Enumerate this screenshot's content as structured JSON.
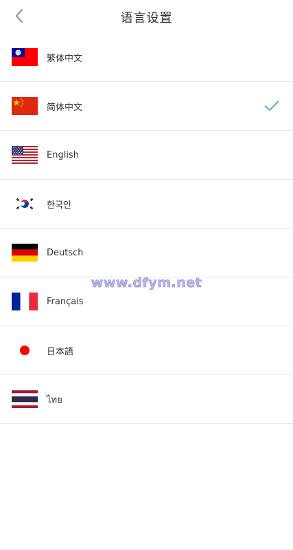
{
  "header": {
    "title": "语言设置",
    "back_icon": "chevron-left-icon"
  },
  "languages": [
    {
      "label": "繁体中文",
      "flag": "taiwan-flag-icon",
      "selected": false
    },
    {
      "label": "简体中文",
      "flag": "china-flag-icon",
      "selected": true
    },
    {
      "label": "English",
      "flag": "usa-flag-icon",
      "selected": false
    },
    {
      "label": "한국인",
      "flag": "korea-flag-icon",
      "selected": false
    },
    {
      "label": "Deutsch",
      "flag": "germany-flag-icon",
      "selected": false
    },
    {
      "label": "Français",
      "flag": "france-flag-icon",
      "selected": false
    },
    {
      "label": "日本語",
      "flag": "japan-flag-icon",
      "selected": false
    },
    {
      "label": "ไทย",
      "flag": "thailand-flag-icon",
      "selected": false
    }
  ],
  "selected_icon": "checkmark-icon",
  "watermark": "www.dfym.net",
  "colors": {
    "check": "#4a90e2",
    "divider": "#e6e6e6",
    "text": "#333333"
  }
}
